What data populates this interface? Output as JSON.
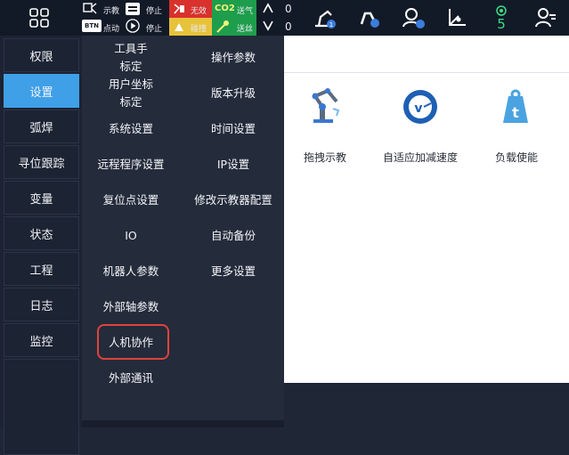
{
  "status": {
    "teach_label": "示教",
    "stop_label_1": "停止",
    "jog_label": "点动",
    "stop_label_2": "停止",
    "invalid_label": "无效",
    "collision_label": "碰撞",
    "co2_label": "CO2",
    "feed_label": "送气",
    "wire_label": "送丝",
    "counter_up": "0",
    "counter_down": "0",
    "btn_label": "BTN",
    "warning_count": "5",
    "user_badge": "1"
  },
  "sidebar": {
    "items": [
      {
        "label": "权限"
      },
      {
        "label": "设置"
      },
      {
        "label": "弧焊"
      },
      {
        "label": "寻位跟踪"
      },
      {
        "label": "变量"
      },
      {
        "label": "状态"
      },
      {
        "label": "工程"
      },
      {
        "label": "日志"
      },
      {
        "label": "监控"
      }
    ]
  },
  "submenu": {
    "left": [
      {
        "line1": "工具手",
        "line2": "标定"
      },
      {
        "line1": "用户坐标",
        "line2": "标定"
      },
      {
        "label": "系统设置"
      },
      {
        "label": "远程程序设置"
      },
      {
        "label": "复位点设置"
      },
      {
        "label": "IO"
      },
      {
        "label": "机器人参数"
      },
      {
        "label": "外部轴参数"
      },
      {
        "label": "人机协作"
      },
      {
        "label": "外部通讯"
      }
    ],
    "right": [
      {
        "label": "操作参数"
      },
      {
        "label": "版本升级"
      },
      {
        "label": "时间设置"
      },
      {
        "label": "IP设置"
      },
      {
        "label": "修改示教器配置"
      },
      {
        "label": "自动备份"
      },
      {
        "label": "更多设置"
      }
    ]
  },
  "features": [
    {
      "label": "拖拽示教",
      "icon": "robot-arm-drag-icon"
    },
    {
      "label": "自适应加减速度",
      "icon": "speedometer-icon"
    },
    {
      "label": "负载使能",
      "icon": "weight-load-icon"
    }
  ],
  "colors": {
    "accent": "#3fa0e8",
    "highlight": "#e0433a",
    "warning_green": "#3ddc84"
  }
}
